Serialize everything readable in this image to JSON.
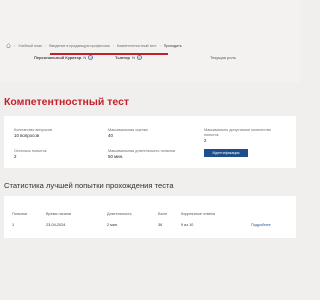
{
  "breadcrumb": {
    "items": [
      "Учебный план",
      "Введение в продающую профессию",
      "Компетентностный тест",
      "Проходить"
    ]
  },
  "roles": {
    "personal_curator": "Персональный Куратор",
    "personal_curator_flag": "N",
    "tutor": "Тьютор",
    "tutor_flag": "N",
    "current_role": "Текущая роль"
  },
  "page_title": "Компетентностный тест",
  "summary": {
    "questions_label": "Количество вопросов",
    "questions_value": "10 вопросов",
    "max_score_label": "Максимальная оценка",
    "max_score_value": "40",
    "max_attempts_label": "Максимально допустимое количество попыток",
    "max_attempts_value": "2",
    "attempts_left_label": "Осталось попыток",
    "attempts_left_value": "2",
    "max_duration_label": "Максимальная длительность попытки",
    "max_duration_value": "50 мин.",
    "identify_button": "Идентификация"
  },
  "stats_title": "Статистика лучшей попытки прохождения теста",
  "table": {
    "headers": [
      "Попытки",
      "Время начала",
      "Длительность",
      "Балл",
      "Корректные ответы"
    ],
    "row": {
      "attempt": "1",
      "start": "23-04-2024",
      "duration": "2 мин.",
      "score": "36",
      "correct": "9 из 10",
      "details": "Подробнее"
    }
  },
  "colors": {
    "accent": "#c4202b",
    "primary": "#1f4e8c",
    "background": "#f1efed"
  }
}
